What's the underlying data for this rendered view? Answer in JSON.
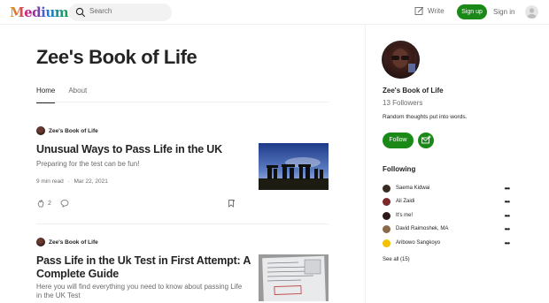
{
  "header": {
    "logo_text": "Medium",
    "search_placeholder": "Search",
    "write_label": "Write",
    "signup_label": "Sign up",
    "signin_label": "Sign in"
  },
  "publication": {
    "title": "Zee's Book of Life",
    "tabs": [
      {
        "label": "Home",
        "active": true
      },
      {
        "label": "About",
        "active": false
      }
    ]
  },
  "posts": [
    {
      "author": "Zee's Book of Life",
      "title": "Unusual Ways to Pass Life in the UK",
      "subtitle": "Preparing for the test can be fun!",
      "read_time": "9 min read",
      "dot": "·",
      "date": "Mar 22, 2021",
      "claps": "2"
    },
    {
      "author": "Zee's Book of Life",
      "title_line1": "Pass Life in the Uk Test in First Attempt: A",
      "title_line2": "Complete Guide",
      "subtitle_line1": "Here you will find everything you need to know about passing Life",
      "subtitle_line2": "in the UK Test"
    }
  ],
  "sidebar": {
    "name": "Zee's Book of Life",
    "followers": "13 Followers",
    "bio": "Random thoughts put into words.",
    "follow_label": "Follow",
    "following_heading": "Following",
    "following": [
      {
        "name": "Saema Kidwai",
        "color": "#3a2a24"
      },
      {
        "name": "Ali Zaidi",
        "color": "#7a2a2a"
      },
      {
        "name": "It's me!",
        "color": "#2b1a18"
      },
      {
        "name": "David Raimoshek, MA",
        "color": "#8a6a4a"
      },
      {
        "name": "Aribowo Sangkoyo",
        "color": "#f2c200"
      }
    ],
    "see_all": "See all (15)"
  },
  "colors": {
    "accent_green": "#1a8917",
    "text_primary": "#242424",
    "text_secondary": "#6b6b6b"
  }
}
